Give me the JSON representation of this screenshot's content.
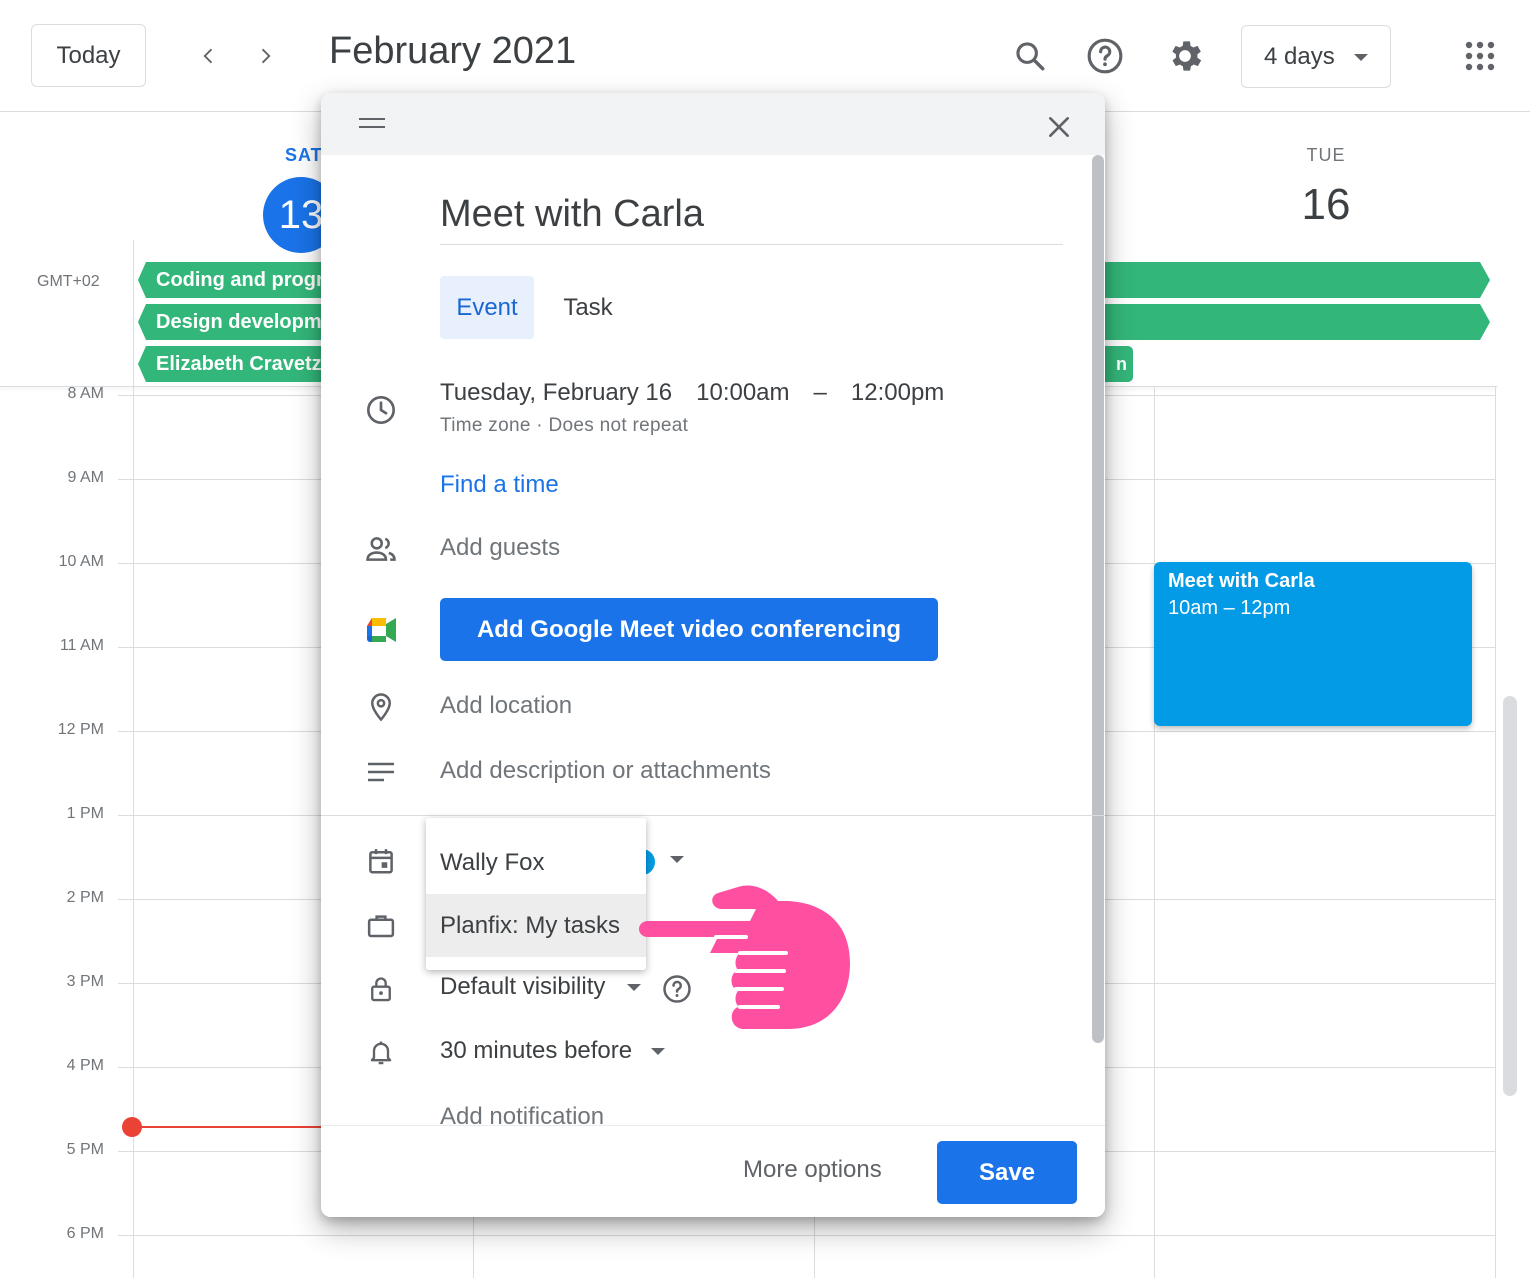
{
  "header": {
    "today_label": "Today",
    "month_title": "February 2021",
    "view_selector": "4 days",
    "icons": [
      "chevron-left-icon",
      "chevron-right-icon",
      "search-icon",
      "help-icon",
      "gear-icon",
      "apps-grid-icon"
    ]
  },
  "days": {
    "sat": {
      "dow": "SAT",
      "num": "13"
    },
    "tue": {
      "dow": "TUE",
      "num": "16"
    }
  },
  "timezone": "GMT+02",
  "allday_events": [
    {
      "title": "Coding and progra"
    },
    {
      "title": "Design developme"
    },
    {
      "title": "Elizabeth Cravetz"
    },
    {
      "title": "n"
    }
  ],
  "hours": [
    "8 AM",
    "9 AM",
    "10 AM",
    "11 AM",
    "12 PM",
    "1 PM",
    "2 PM",
    "3 PM",
    "4 PM",
    "5 PM",
    "6 PM"
  ],
  "grid_event": {
    "title": "Meet with Carla",
    "time": "10am – 12pm",
    "color": "#039be5"
  },
  "dialog": {
    "title_value": "Meet with Carla",
    "tabs": {
      "event": "Event",
      "task": "Task"
    },
    "when": {
      "date": "Tuesday, February 16",
      "start": "10:00am",
      "dash": "–",
      "end": "12:00pm",
      "sub": "Time zone · Does not repeat"
    },
    "find_time": "Find a time",
    "add_guests": "Add guests",
    "meet_button": "Add Google Meet video conferencing",
    "add_location": "Add location",
    "add_description": "Add description or attachments",
    "calendar_menu": {
      "items": [
        "Wally Fox",
        "Planfix: My tasks"
      ],
      "highlighted": "Planfix: My tasks"
    },
    "visibility": "Default visibility",
    "notification": "30 minutes before",
    "add_notification": "Add notification",
    "more_options": "More options",
    "save": "Save"
  },
  "colors": {
    "accent": "#1a73e8",
    "allday_green": "#33b679",
    "now_red": "#ea4335",
    "hand_pink": "#ff4fa0"
  }
}
